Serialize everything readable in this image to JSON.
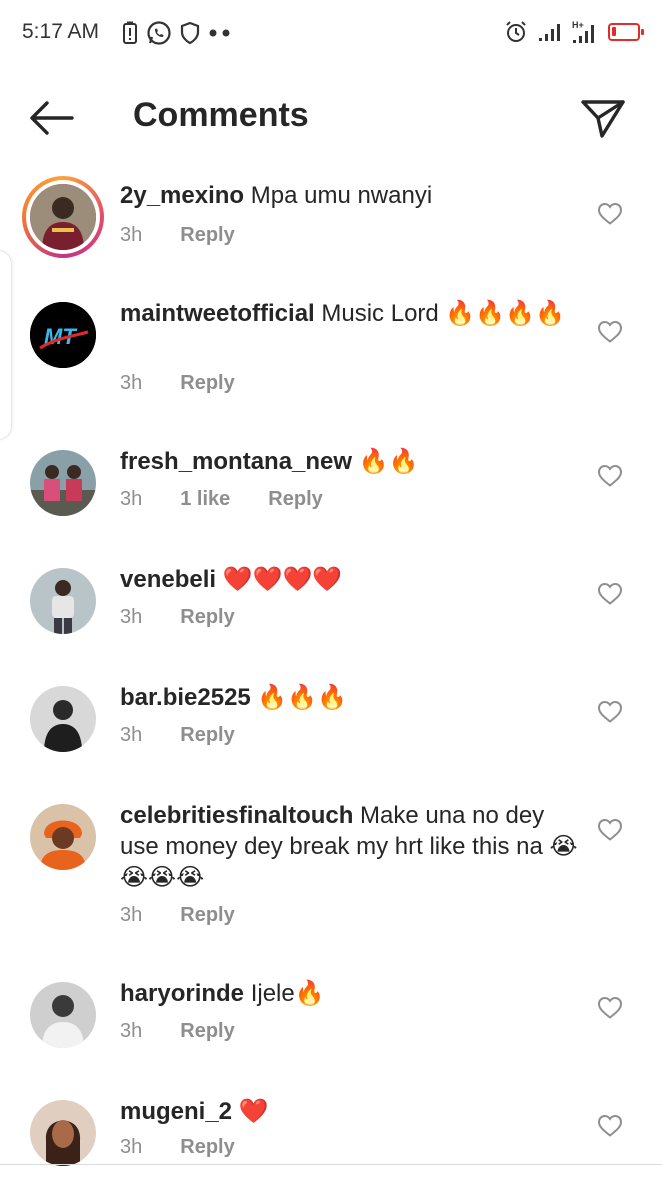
{
  "status_bar": {
    "time": "5:17 AM",
    "left_icons": [
      "battery-saver-icon",
      "whatsapp-icon",
      "shield-icon",
      "more-dots-icon"
    ],
    "right_icons": [
      "alarm-icon",
      "signal-icon",
      "signal-h-plus-icon",
      "battery-icon"
    ],
    "battery_color": "#e32b2b"
  },
  "header": {
    "title": "Comments",
    "back_icon": "arrow-left-icon",
    "send_icon": "paper-plane-icon"
  },
  "comments": [
    {
      "username": "2y_mexino",
      "text": " Mpa umu nwanyi",
      "time": "3h",
      "likes": "",
      "reply": "Reply",
      "story_ring": true,
      "avatar_color": "#7a2b3c"
    },
    {
      "username": "maintweetofficial",
      "text": " Music Lord 🔥🔥🔥🔥",
      "time": "3h",
      "likes": "",
      "reply": "Reply",
      "story_ring": false,
      "avatar_color": "#000000",
      "avatar_logo": "MT"
    },
    {
      "username": "fresh_montana_new",
      "text": " 🔥🔥",
      "time": "3h",
      "likes": "1 like",
      "reply": "Reply",
      "story_ring": false,
      "avatar_color": "#7d5f6a"
    },
    {
      "username": "venebeli",
      "text": " ❤️❤️❤️❤️",
      "time": "3h",
      "likes": "",
      "reply": "Reply",
      "story_ring": false,
      "avatar_color": "#8d8a86"
    },
    {
      "username": "bar.bie2525",
      "text": " 🔥🔥🔥",
      "time": "3h",
      "likes": "",
      "reply": "Reply",
      "story_ring": false,
      "avatar_color": "#4a4a4a"
    },
    {
      "username": "celebritiesfinaltouch",
      "text": " Make una no dey use money dey break my hrt like this na 😭😭😭😭",
      "time": "3h",
      "likes": "",
      "reply": "Reply",
      "story_ring": false,
      "avatar_color": "#b0552a"
    },
    {
      "username": "haryorinde",
      "text": " Ijele🔥",
      "time": "3h",
      "likes": "",
      "reply": "Reply",
      "story_ring": false,
      "avatar_color": "#8c8c8c"
    },
    {
      "username": "mugeni_2",
      "text": " ❤️",
      "time": "3h",
      "likes": "",
      "reply": "Reply",
      "story_ring": false,
      "avatar_color": "#6b4a3a"
    }
  ]
}
